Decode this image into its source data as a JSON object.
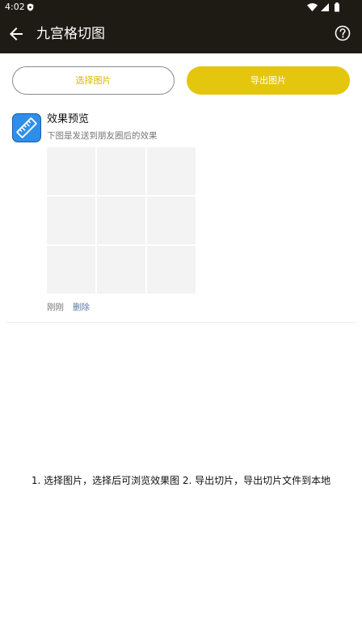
{
  "status_bar": {
    "time": "4:02"
  },
  "app_bar": {
    "title": "九宫格切图"
  },
  "actions": {
    "select_label": "选择图片",
    "export_label": "导出图片"
  },
  "preview": {
    "title": "效果预览",
    "subtitle": "下图是发送到朋友圈后的效果",
    "time": "刚刚",
    "delete_label": "删除"
  },
  "instructions": "1. 选择图片，选择后可浏览效果图 2. 导出切片，导出切片文件到本地",
  "colors": {
    "app_bar": "#1e1b14",
    "accent": "#e5c60f",
    "icon_bg": "#2f8ee8"
  }
}
